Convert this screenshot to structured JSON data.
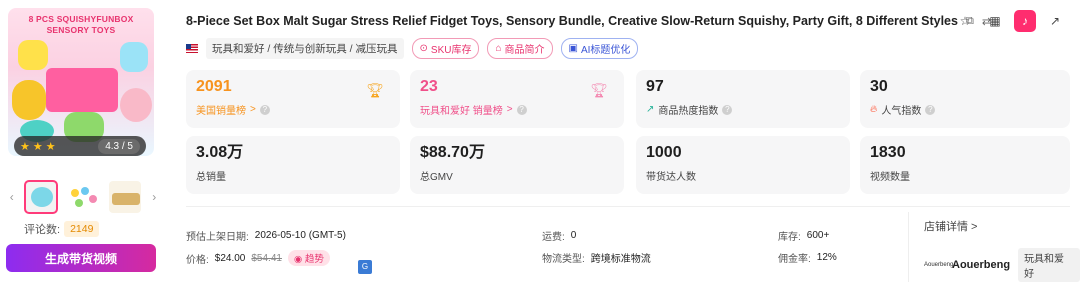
{
  "product": {
    "title": "8-Piece Set Box Malt Sugar Stress Relief Fidget Toys, Sensory Bundle, Creative Slow-Return Squishy, Party Gift, 8 Different Styles",
    "image_brand_text": "8 PCS  SQUISHYFUNBOX\nSENSORY TOYS",
    "rating": "4.3 / 5",
    "rating_value": 4.3,
    "reviews_label": "评论数:",
    "reviews_count": "2149",
    "cta_label": "生成带货视频"
  },
  "meta": {
    "category_path": "玩具和爱好 / 传统与创新玩具 / 减压玩具",
    "tags": [
      "SKU库存",
      "商品简介",
      "AI标题优化"
    ]
  },
  "stats": [
    {
      "value": "2091",
      "label": "美国销量榜",
      "suffix": ">",
      "style": "orange",
      "icon": "trophy-icon"
    },
    {
      "value": "23",
      "label": "玩具和爱好 销量榜",
      "suffix": ">",
      "style": "pink",
      "icon": "trophy-icon"
    },
    {
      "value": "97",
      "label": "商品热度指数",
      "icon": "trend-icon"
    },
    {
      "value": "30",
      "label": "人气指数",
      "icon": "fire-icon"
    },
    {
      "value": "3.08万",
      "label": "总销量"
    },
    {
      "value": "$88.70万",
      "label": "总GMV"
    },
    {
      "value": "1000",
      "label": "带货达人数"
    },
    {
      "value": "1830",
      "label": "视频数量"
    }
  ],
  "details": {
    "launch_label": "预估上架日期:",
    "launch_value": "2026-05-10 (GMT-5)",
    "price_label": "价格:",
    "price_value": "$24.00",
    "price_original": "$54.41",
    "trend_label": "趋势",
    "shipping_label": "运费:",
    "shipping_value": "0",
    "logistics_label": "物流类型:",
    "logistics_value": "跨境标准物流",
    "stock_label": "库存:",
    "stock_value": "600+",
    "commission_label": "佣金率:",
    "commission_value": "12%"
  },
  "shop": {
    "link_label": "店铺详情 >",
    "logo_text": "Aouerbeng",
    "name": "Aouerbeng",
    "category": "玩具和爱好"
  },
  "colors": {
    "accent_pink": "#ff2d6f",
    "orange": "#f7931e",
    "cta_gradient_start": "#8d2cf0",
    "cta_gradient_end": "#d62a9f"
  }
}
